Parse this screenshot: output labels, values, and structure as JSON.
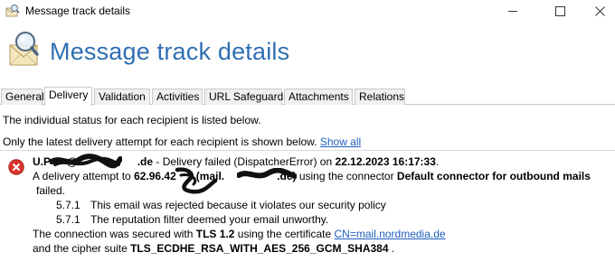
{
  "window": {
    "title": "Message track details"
  },
  "header": {
    "title": "Message track details"
  },
  "tabs": [
    {
      "label": "General",
      "active": false
    },
    {
      "label": "Delivery",
      "active": true
    },
    {
      "label": "Validation",
      "active": false
    },
    {
      "label": "Activities",
      "active": false
    },
    {
      "label": "URL Safeguard",
      "active": false
    },
    {
      "label": "Attachments",
      "active": false
    },
    {
      "label": "Relations",
      "active": false
    }
  ],
  "info": {
    "status_text": "The individual status for each recipient is listed below.",
    "latest_text": "Only the latest delivery attempt for each recipient is shown below.",
    "show_all_link": "Show all"
  },
  "recipient": {
    "address_start": "U.P",
    "address_mid": "@",
    "address_end": ".de",
    "status_text": " - Delivery failed (DispatcherError) on ",
    "datetime": "22.12.2023 16:17:33",
    "datetime_suffix": ".",
    "attempt_prefix": "A delivery attempt to ",
    "ip_start": "62.96.42",
    "ip_end": "5",
    "host_start": " (mail.",
    "host_end": ".de)",
    "attempt_middle": " using the connector ",
    "connector": "Default connector for outbound mails",
    "failed_word": "failed.",
    "errors": [
      {
        "code": "5.7.1",
        "text": "This email was rejected because it violates our security policy"
      },
      {
        "code": "5.7.1",
        "text": "The reputation filter deemed your email unworthy."
      }
    ],
    "tls_prefix": "The connection was secured with ",
    "tls_version": "TLS 1.2",
    "tls_middle": " using the certificate ",
    "certificate": "CN=mail.nordmedia.de",
    "cipher_prefix": "and the cipher suite ",
    "cipher": "TLS_ECDHE_RSA_WITH_AES_256_GCM_SHA384",
    "cipher_suffix": " ."
  },
  "colors": {
    "title_blue": "#2f6fb2",
    "link_blue": "#1f5fbf",
    "error_red": "#d9342b"
  }
}
